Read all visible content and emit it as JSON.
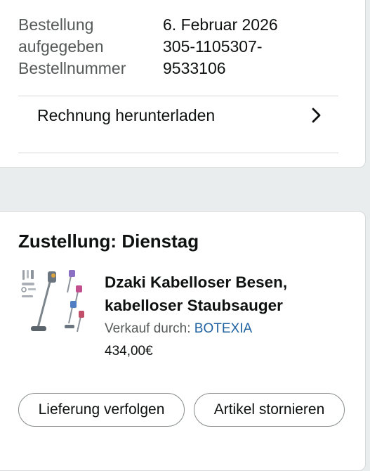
{
  "order_info": {
    "labels": "Bestellung\naufgegeben\nBestellnummer",
    "values": "6. Februar 2026\n305-1105307-\n9533106"
  },
  "invoice": {
    "label": "Rechnung herunterladen",
    "chevron_icon": "chevron-right-icon"
  },
  "delivery": {
    "heading": "Zustellung: Dienstag",
    "product": {
      "image_icon": "cordless-vacuum-product-image",
      "title": "Dzaki Kabelloser Besen,\nkabelloser Staubsauger",
      "seller_prefix": "Verkauf durch: ",
      "seller_name": "BOTEXIA",
      "price": "434,00€"
    },
    "actions": {
      "track_label": "Lieferung verfolgen",
      "cancel_label": "Artikel stornieren"
    }
  },
  "colors": {
    "page_background": "#eaeded",
    "card_border": "#d5d9d9",
    "link": "#2162a1",
    "secondary_text": "#565959",
    "primary_text": "#0f1111"
  }
}
